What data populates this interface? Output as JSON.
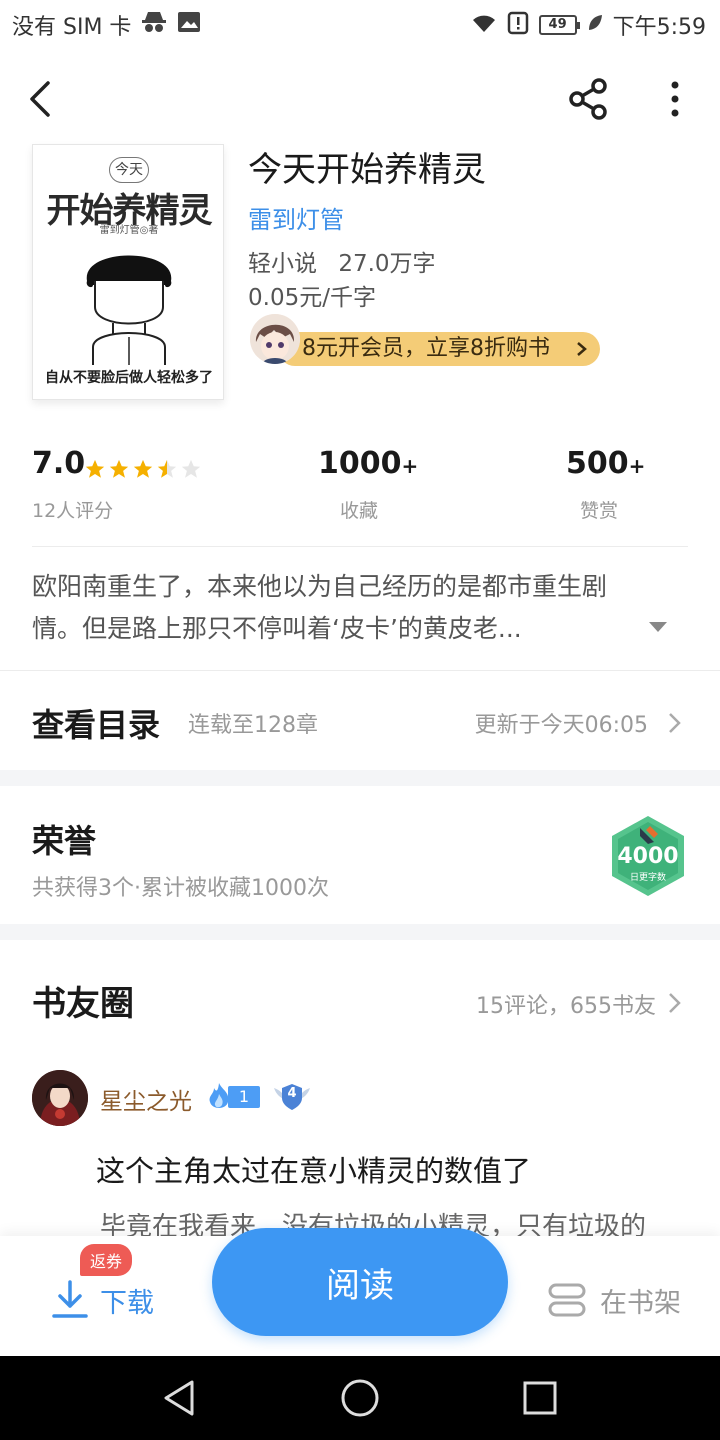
{
  "status_bar": {
    "carrier": "没有 SIM 卡",
    "battery": "49",
    "time": "下午5:59"
  },
  "book": {
    "title": "今天开始养精灵",
    "author": "雷到灯管",
    "category": "轻小说",
    "word_count": "27.0万字",
    "price": "0.05元/千字",
    "cover_text": {
      "top": "今天",
      "title": "开始养精灵",
      "author": "雷到灯管◎著",
      "tagline": "自从不要脸后做人轻松多了"
    }
  },
  "vip_banner": {
    "text": "8元开会员，立享8折购书"
  },
  "stats": {
    "rating": "7.0",
    "rating_count": "12人评分",
    "rating_stars": 3.5,
    "favorites": "1000",
    "favorites_label": "收藏",
    "tips": "500",
    "tips_label": "赞赏",
    "plus": "+"
  },
  "synopsis": {
    "line1": "欧阳南重生了，本来他以为自己经历的是都市重生剧",
    "line2": "情。但是路上那只不停叫着‘皮卡’的黄皮老..."
  },
  "catalog": {
    "title": "查看目录",
    "progress": "连载至128章",
    "updated": "更新于今天06:05"
  },
  "honor": {
    "title": "荣誉",
    "summary": "共获得3个·累计被收藏1000次",
    "badge_value": "4000",
    "badge_label": "日更字数"
  },
  "circle": {
    "title": "书友圈",
    "stats": "15评论，655书友"
  },
  "comment": {
    "username": "星尘之光",
    "fire_level": "1",
    "member_level": "4",
    "title": "这个主角太过在意小精灵的数值了",
    "body": "毕竟在我看来，没有垃圾的小精灵，只有垃圾的"
  },
  "bottom_bar": {
    "coupon": "返券",
    "download": "下载",
    "read": "阅读",
    "shelf": "在书架"
  },
  "colors": {
    "accent_blue": "#3d97f3",
    "link_blue": "#3d8fe8",
    "star": "#f5b000",
    "vip_gold": "#f4cc77",
    "badge_green": "#4cc38a",
    "coupon_red": "#ee5b55"
  }
}
